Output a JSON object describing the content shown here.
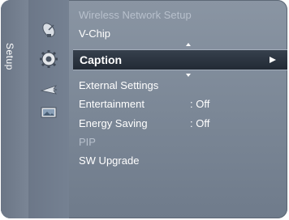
{
  "side_tab": {
    "label": "Setup"
  },
  "category_icons": [
    "satellite-dish-icon",
    "gear-icon",
    "plane-icon",
    "picture-icon"
  ],
  "menu": {
    "items": [
      {
        "label": "Wireless Network Setup",
        "value": "",
        "state": "dim"
      },
      {
        "label": "V-Chip",
        "value": "",
        "state": "normal"
      },
      {
        "label": "Caption",
        "value": "",
        "state": "selected"
      },
      {
        "label": "External Settings",
        "value": "",
        "state": "normal"
      },
      {
        "label": "Entertainment",
        "value": ": Off",
        "state": "normal"
      },
      {
        "label": "Energy Saving",
        "value": ": Off",
        "state": "normal"
      },
      {
        "label": "PIP",
        "value": "",
        "state": "dim"
      },
      {
        "label": "SW Upgrade",
        "value": "",
        "state": "normal"
      }
    ]
  },
  "colors": {
    "background": "#7d8998",
    "selected_bar": "#222a35",
    "text": "#ffffff",
    "dim_text": "#b7c0cc"
  }
}
